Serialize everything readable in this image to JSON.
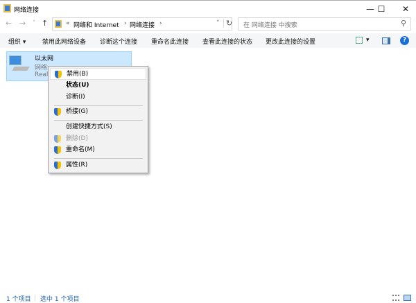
{
  "window": {
    "title": "网络连接",
    "minimize": "—",
    "maximize": "☐",
    "close": "✕"
  },
  "nav": {
    "back": "←",
    "forward": "→",
    "recent": "˅",
    "up": "↑"
  },
  "address": {
    "overflow": "«",
    "crumbs": [
      "网络和 Internet",
      "网络连接"
    ],
    "sep": "›",
    "dropdown": "˅",
    "refresh": "↻"
  },
  "search": {
    "placeholder": "在 网络连接 中搜索",
    "icon": "⚲"
  },
  "toolbar": {
    "organize": "组织 ▾",
    "items": [
      "禁用此网络设备",
      "诊断这个连接",
      "重命名此连接",
      "查看此连接的状态",
      "更改此连接的设置"
    ],
    "view_dropdown": "▾",
    "help": "?"
  },
  "item": {
    "name": "以太网",
    "line2": "网络",
    "line3": "Real"
  },
  "menu": {
    "items": [
      {
        "label": "禁用(B)",
        "shield": true
      },
      {
        "label": "状态(U)",
        "bold": true
      },
      {
        "label": "诊断(I)"
      },
      {
        "label": "桥接(G)",
        "shield": true
      },
      {
        "label": "创建快捷方式(S)"
      },
      {
        "label": "删除(D)",
        "shield": true,
        "disabled": true
      },
      {
        "label": "重命名(M)",
        "shield": true
      },
      {
        "label": "属性(R)",
        "shield": true
      }
    ]
  },
  "statusbar": {
    "count": "1 个项目",
    "selected": "选中 1 个项目"
  }
}
